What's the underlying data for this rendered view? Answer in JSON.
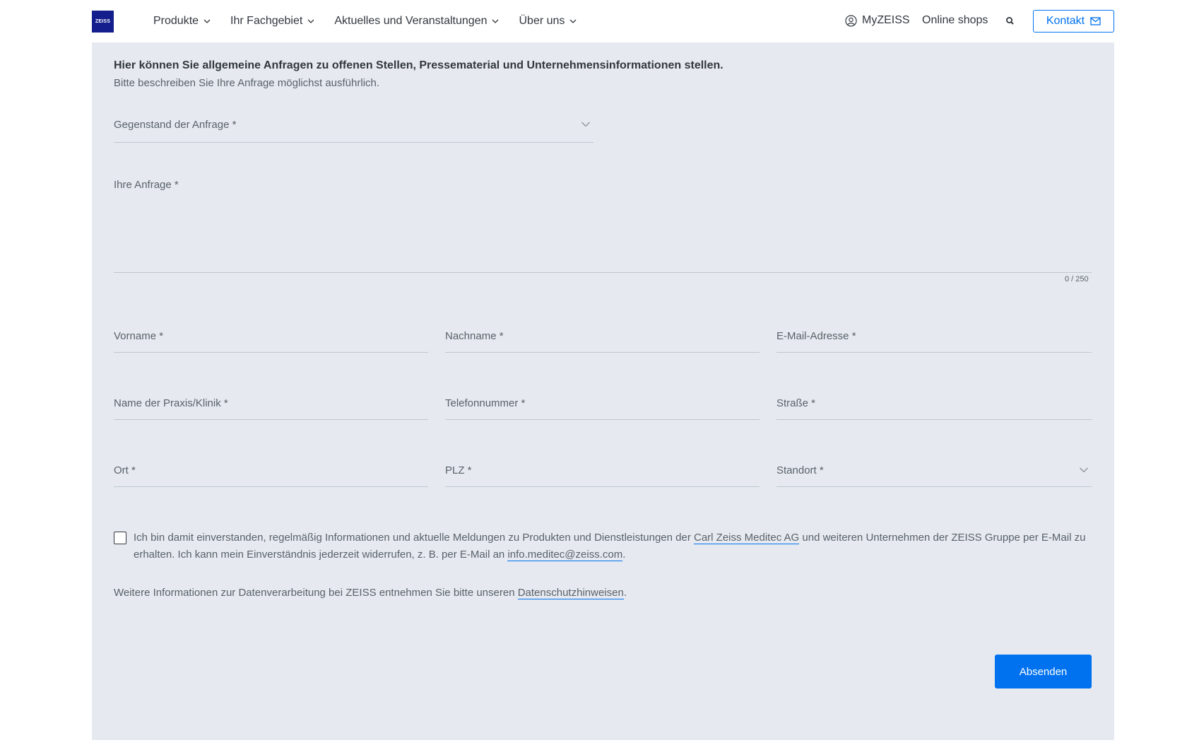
{
  "header": {
    "logo_text": "ZEISS",
    "nav": [
      {
        "label": "Produkte"
      },
      {
        "label": "Ihr Fachgebiet"
      },
      {
        "label": "Aktuelles und Veranstaltungen"
      },
      {
        "label": "Über uns"
      }
    ],
    "myzeiss_label": "MyZEISS",
    "shops_label": "Online shops",
    "kontakt_label": "Kontakt"
  },
  "form": {
    "intro_bold": "Hier können Sie allgemeine Anfragen zu offenen Stellen, Pressematerial und Unternehmensinformationen stellen.",
    "intro_sub": "Bitte beschreiben Sie Ihre Anfrage möglichst ausführlich.",
    "subject_label": "Gegenstand der Anfrage *",
    "request_label": "Ihre Anfrage *",
    "counter": "0 / 250",
    "fields": {
      "vorname": "Vorname *",
      "nachname": "Nachname *",
      "email": "E-Mail-Adresse *",
      "praxis": "Name der Praxis/Klinik *",
      "telefon": "Telefonnummer *",
      "strasse": "Straße *",
      "ort": "Ort *",
      "plz": "PLZ *",
      "standort": "Standort *"
    },
    "consent": {
      "text_1": "Ich bin damit einverstanden, regelmäßig Informationen und aktuelle Meldungen zu Produkten und Dienstleistungen der ",
      "link_company": "Carl Zeiss Meditec AG",
      "text_2": " und weiteren Unternehmen der ZEISS Gruppe per E-Mail zu erhalten. Ich kann mein Einverständnis jederzeit widerrufen, z. B. per E-Mail an ",
      "link_email": "info.meditec@zeiss.com",
      "text_3": "."
    },
    "privacy": {
      "text_1": "Weitere Informationen zur Datenverarbeitung bei ZEISS entnehmen Sie bitte unseren ",
      "link": "Datenschutzhinweisen",
      "text_2": "."
    },
    "submit_label": "Absenden"
  },
  "colors": {
    "accent": "#0072ef",
    "brand": "#141e8c",
    "panel_bg": "#e6eaf0"
  }
}
